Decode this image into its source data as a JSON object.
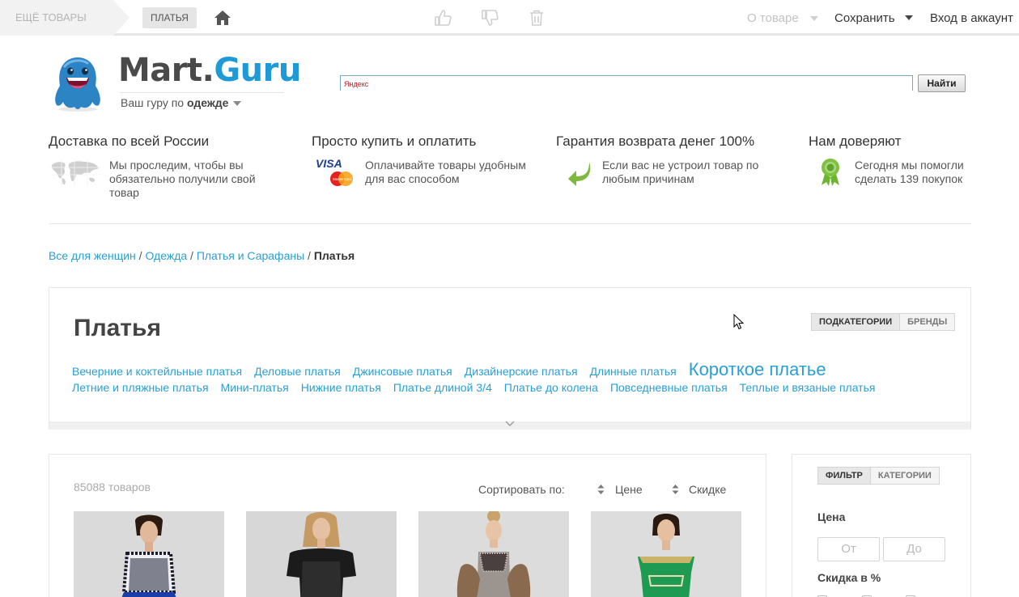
{
  "topbar": {
    "more_items": "ЕЩЁ ТОВАРЫ",
    "current_tag": "ПЛАТЬЯ",
    "about": "О товаре",
    "save": "Сохранить",
    "login": "Вход в аккаунт"
  },
  "header": {
    "logo_part1": "Mart.",
    "logo_part2": "Guru",
    "tagline_prefix": "Ваш гуру по",
    "tagline_bold": "одежде",
    "search_placeholder": "Яндекс",
    "search_button": "Найти"
  },
  "benefits": [
    {
      "title": "Доставка по всей России",
      "text": "Мы проследим, чтобы вы обязательно получили свой товар"
    },
    {
      "title": "Просто купить и оплатить",
      "text": "Оплачивайте товары удобным для вас способом"
    },
    {
      "title": "Гарантия возврата денег 100%",
      "text": "Если вас не устроил товар по любым причинам"
    },
    {
      "title": "Нам доверяют",
      "text": "Сегодня мы помогли сделать 139 покупок"
    }
  ],
  "visa_label": "VISA",
  "mastercard_label": "MasterCard",
  "breadcrumb": {
    "items": [
      "Все для женщин",
      "Одежда",
      "Платья и Сарафаны"
    ],
    "separator": "/",
    "current": "Платья"
  },
  "category": {
    "title": "Платья",
    "tabs": [
      "ПОДКАТЕГОРИИ",
      "БРЕНДЫ"
    ],
    "row1": [
      "Вечерние и коктейльные платья",
      "Деловые платья",
      "Джинсовые платья",
      "Дизайнерские платья",
      "Длинные платья",
      "Короткое платье"
    ],
    "row2": [
      "Летние и пляжные платья",
      "Мини-платья",
      "Нижние платья",
      "Платье длиной 3/4",
      "Платье до колена",
      "Повседневные платья",
      "Теплые и вязаные платья"
    ]
  },
  "products": {
    "count": "85088 товаров",
    "sort_label": "Сортировать по:",
    "sort_options": [
      "Цене",
      "Скидке"
    ]
  },
  "filter": {
    "tabs": [
      "ФИЛЬТР",
      "КАТЕГОРИИ"
    ],
    "price_label": "Цена",
    "price_from": "От",
    "price_to": "До",
    "discount_label": "Скидка в %"
  },
  "colors": {
    "link": "#2a9fd6",
    "logo_blue": "#1e9ad6",
    "logo_dark": "#4a4a4a"
  }
}
